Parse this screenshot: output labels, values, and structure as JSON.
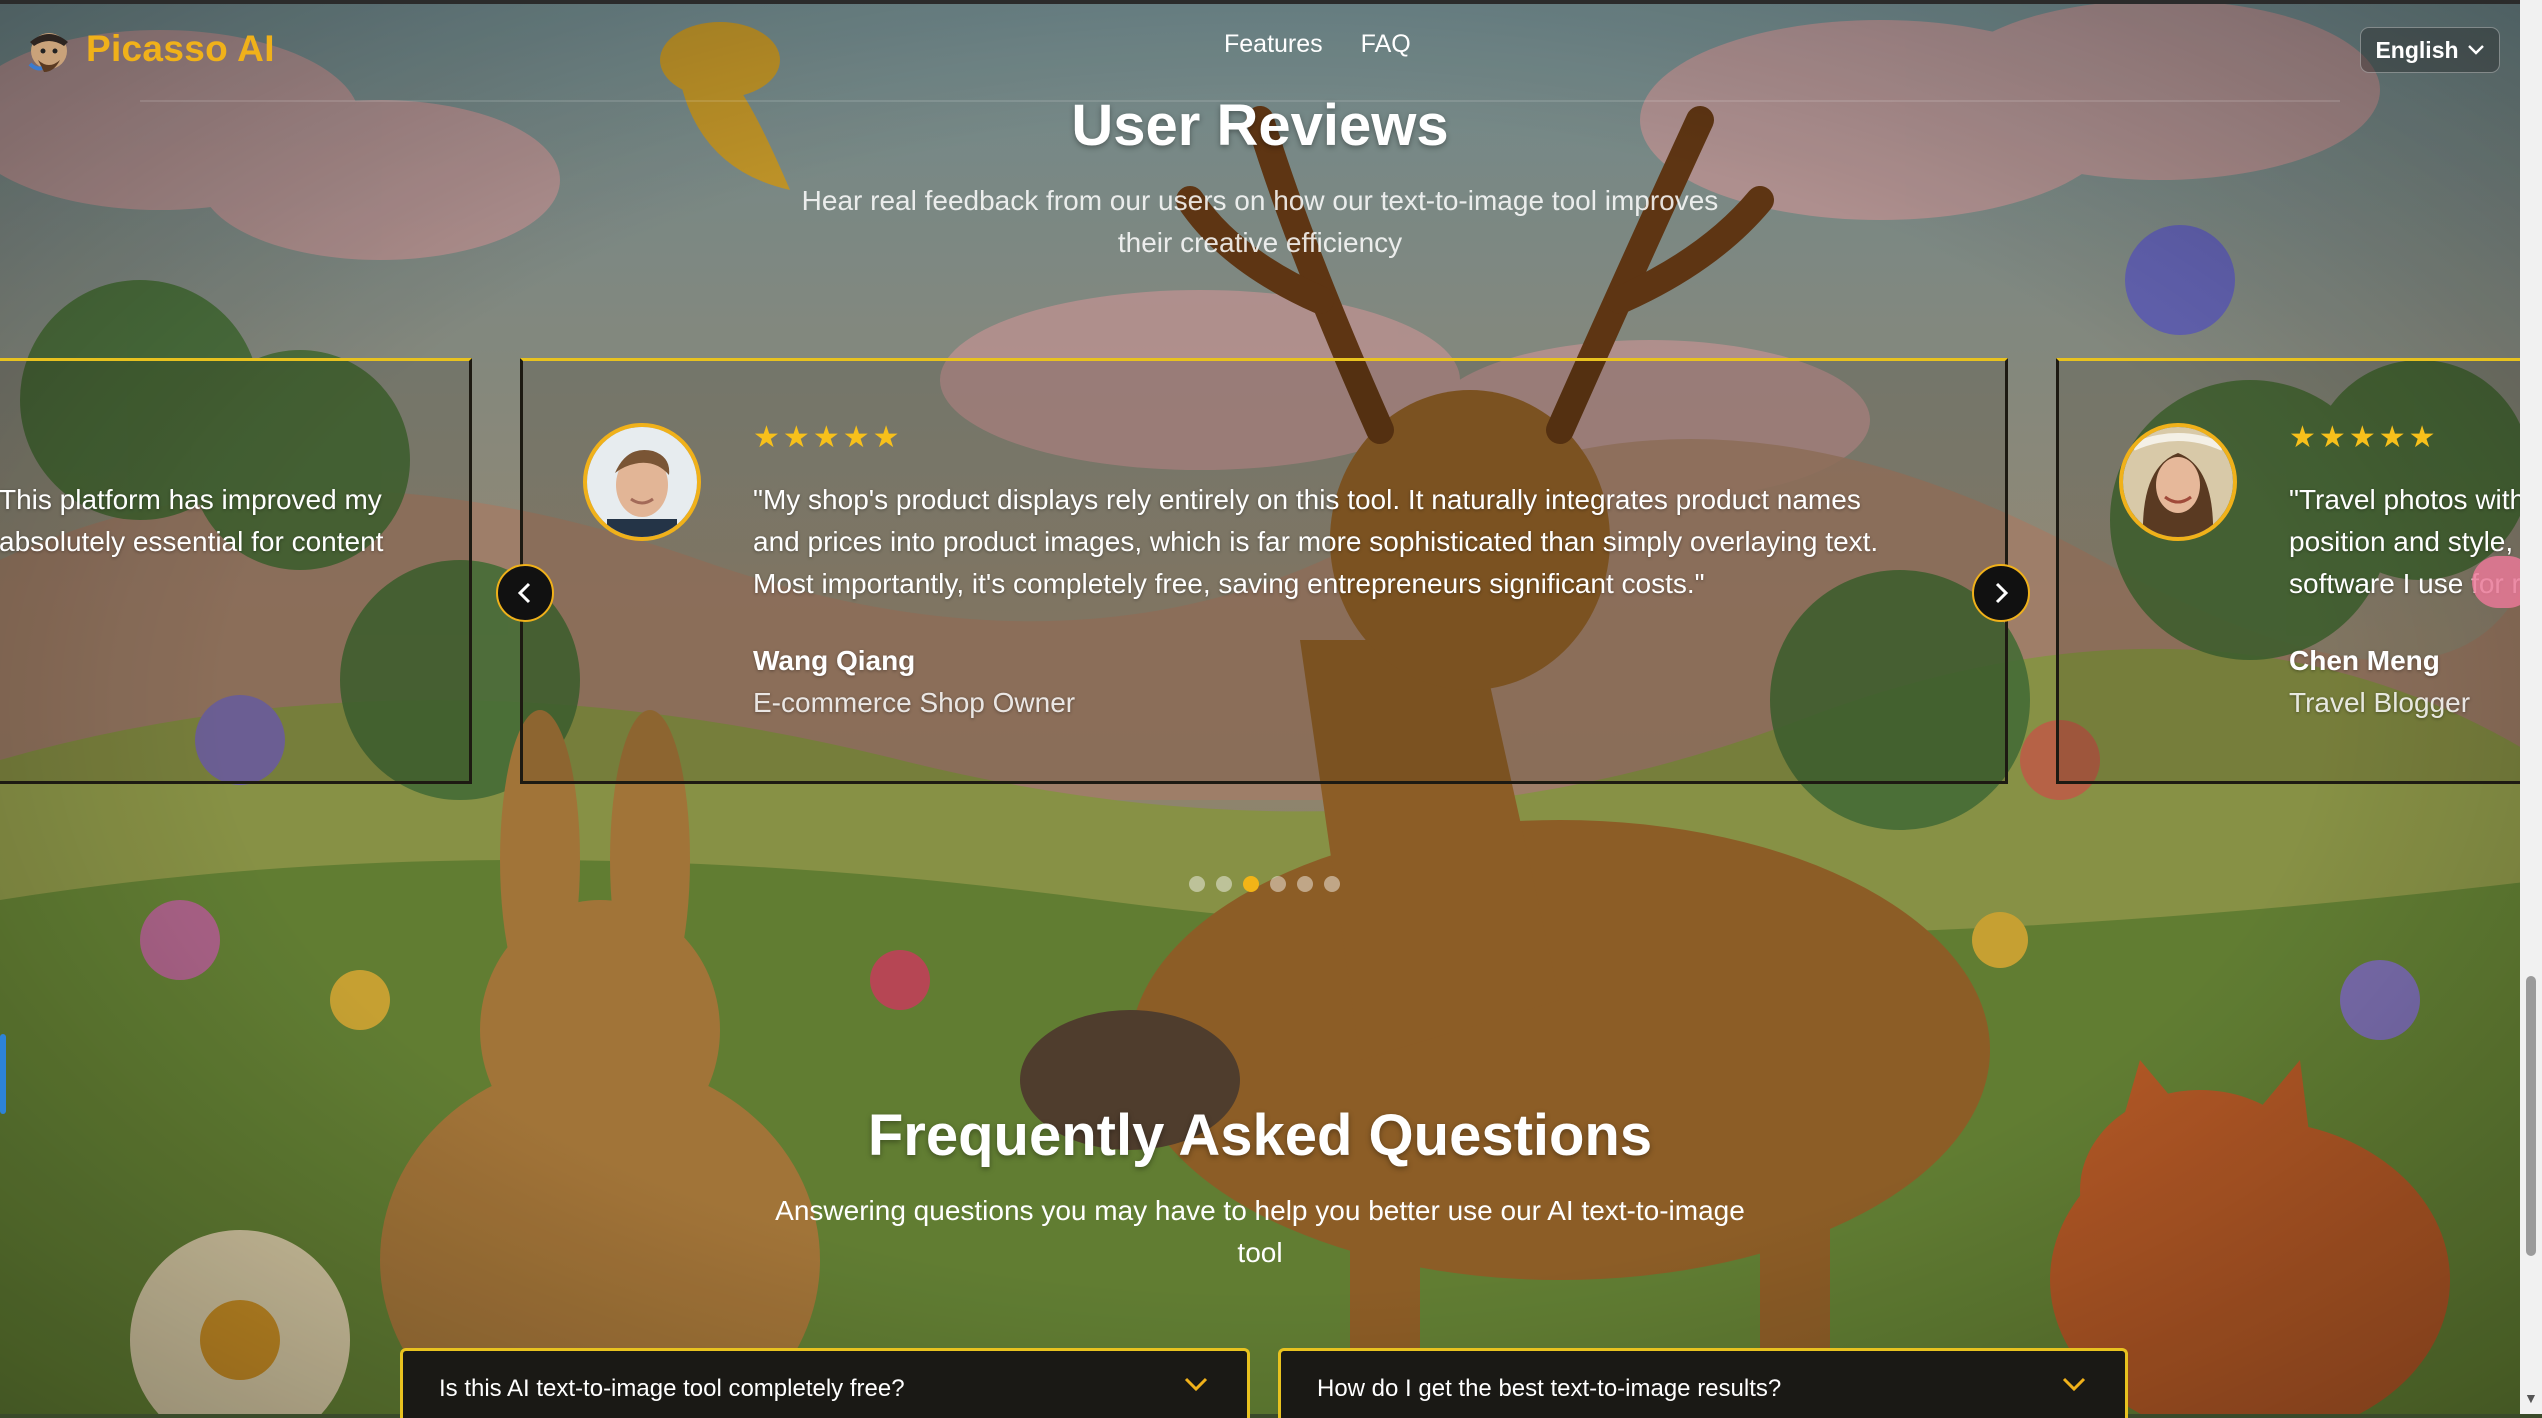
{
  "brand": {
    "name": "Picasso AI",
    "accent": "#f0b11a"
  },
  "nav": {
    "items": [
      "Features",
      "FAQ"
    ]
  },
  "language": {
    "selected": "English"
  },
  "reviews": {
    "title": "User Reviews",
    "subtitle_line1": "Hear real feedback from our users on how our text-to-image tool improves",
    "subtitle_line2": "their creative efficiency",
    "left_card": {
      "line1": "This platform has improved my",
      "line2": "absolutely essential for content"
    },
    "main_card": {
      "rating": 5,
      "line1": "\"My shop's product displays rely entirely on this tool. It naturally integrates product names",
      "line2": "and prices into product images, which is far more sophisticated than simply overlaying text.",
      "line3": "Most importantly, it's completely free, saving entrepreneurs significant costs.\"",
      "author": "Wang Qiang",
      "role": "E-commerce Shop Owner"
    },
    "right_card": {
      "rating": 5,
      "line1": "\"Travel photos with",
      "line2": "position and style,",
      "line3": "software I use for r",
      "author": "Chen Meng",
      "role": "Travel Blogger"
    },
    "pagination": {
      "total": 6,
      "active_index": 2
    }
  },
  "faq": {
    "title": "Frequently Asked Questions",
    "subtitle_line1": "Answering questions you may have to help you better use our AI text-to-image",
    "subtitle_line2": "tool",
    "items": [
      {
        "question": "Is this AI text-to-image tool completely free?"
      },
      {
        "question": "How do I get the best text-to-image results?"
      }
    ]
  },
  "icons": {
    "logo": "painter-avatar-icon",
    "language_toggle": "chevron-down-icon",
    "prev": "chevron-left-icon",
    "next": "chevron-right-icon",
    "star": "star-icon",
    "faq_toggle": "chevron-down-icon"
  }
}
